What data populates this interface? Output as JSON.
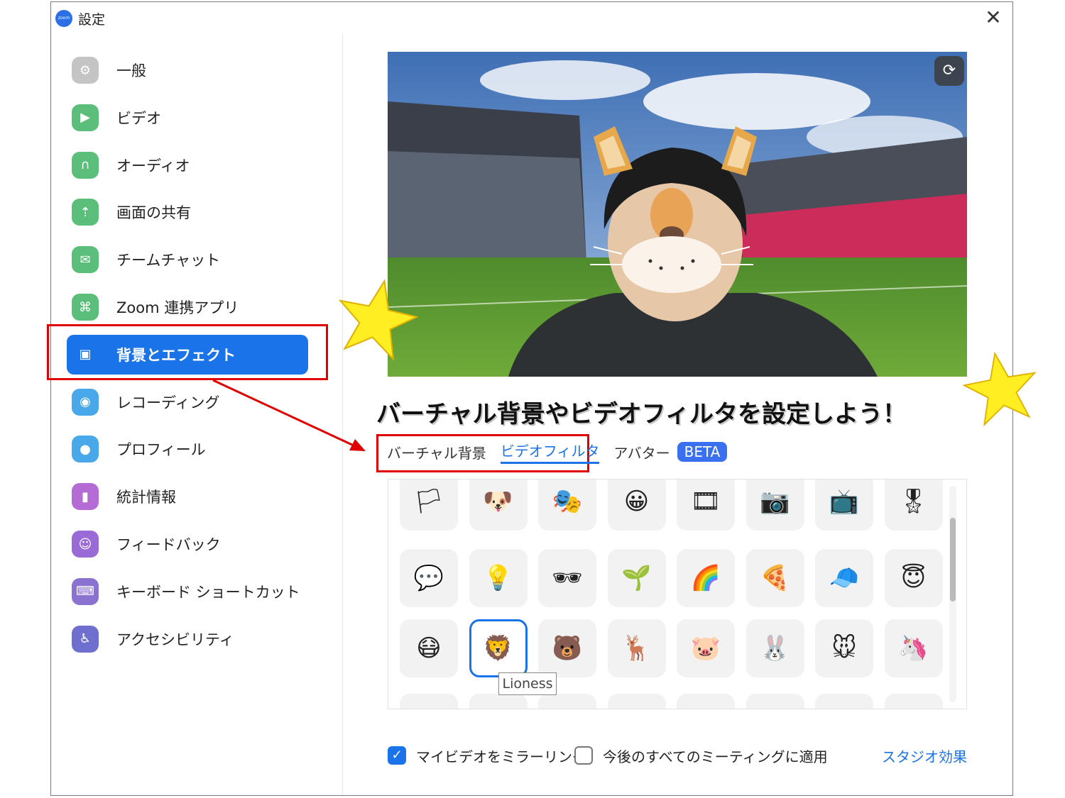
{
  "window": {
    "title": "設定",
    "logo_text": "zoom",
    "close_glyph": "✕"
  },
  "sidebar": {
    "items": [
      {
        "label": "一般",
        "icon": "gear-icon",
        "color": "#c4c4c4",
        "glyph": "⚙"
      },
      {
        "label": "ビデオ",
        "icon": "video-camera-icon",
        "color": "#5bbf7b",
        "glyph": "▶"
      },
      {
        "label": "オーディオ",
        "icon": "headphones-icon",
        "color": "#5bbf7b",
        "glyph": "∩"
      },
      {
        "label": "画面の共有",
        "icon": "share-screen-icon",
        "color": "#5bbf7b",
        "glyph": "⇡"
      },
      {
        "label": "チームチャット",
        "icon": "chat-icon",
        "color": "#5bbf7b",
        "glyph": "✉"
      },
      {
        "label": "Zoom 連携アプリ",
        "icon": "apps-icon",
        "color": "#5bbf7b",
        "glyph": "⌘"
      },
      {
        "label": "背景とエフェクト",
        "icon": "background-effects-icon",
        "color": "#1a73e8",
        "glyph": "▣",
        "active": true
      },
      {
        "label": "レコーディング",
        "icon": "record-icon",
        "color": "#49a8ea",
        "glyph": "◉"
      },
      {
        "label": "プロフィール",
        "icon": "profile-icon",
        "color": "#49a8ea",
        "glyph": "●"
      },
      {
        "label": "統計情報",
        "icon": "statistics-icon",
        "color": "#b56bd6",
        "glyph": "▮"
      },
      {
        "label": "フィードバック",
        "icon": "feedback-icon",
        "color": "#9a6bd6",
        "glyph": "☺"
      },
      {
        "label": "キーボード ショートカット",
        "icon": "keyboard-icon",
        "color": "#8a72d0",
        "glyph": "⌨"
      },
      {
        "label": "アクセシビリティ",
        "icon": "accessibility-icon",
        "color": "#6f6fd0",
        "glyph": "♿"
      }
    ]
  },
  "annotation": {
    "headline": "バーチャル背景やビデオフィルタを設定しよう！",
    "highlight_color": "#e00000",
    "star_color": "#ffee22"
  },
  "tabs": [
    {
      "label": "バーチャル背景",
      "active": false
    },
    {
      "label": "ビデオフィルタ",
      "active": true
    },
    {
      "label": "アバター",
      "active": false
    }
  ],
  "beta_badge": "BETA",
  "filters": {
    "tooltip": "Lioness",
    "rows": [
      [
        "pride-frame",
        "corgi-frame",
        "theater",
        "emoji-frame",
        "filmstrip",
        "camera-frame",
        "tv-frame",
        "award-ribbon"
      ],
      [
        "huh-bubble",
        "holiday-lights",
        "sunglasses",
        "sprout-face",
        "rainbow-face",
        "pizza-face",
        "cap-face",
        "halo-face"
      ],
      [
        "face-mask",
        "lioness",
        "bear",
        "reindeer",
        "pig",
        "bunny",
        "mouse",
        "unicorn"
      ]
    ],
    "row_glyphs": [
      [
        "🏳",
        "🐶",
        "🎭",
        "😀",
        "🎞",
        "📷",
        "📺",
        "🎖"
      ],
      [
        "💬",
        "💡",
        "🕶",
        "🌱",
        "🌈",
        "🍕",
        "🧢",
        "😇"
      ],
      [
        "😷",
        "🦁",
        "🐻",
        "🦌",
        "🐷",
        "🐰",
        "🐭",
        "🦄"
      ]
    ],
    "selected": "lioness"
  },
  "footer": {
    "mirror_label": "マイビデオをミラーリング",
    "mirror_checked": true,
    "apply_all_label": "今後のすべてのミーティングに適用",
    "apply_all_checked": false,
    "studio_link": "スタジオ効果"
  }
}
